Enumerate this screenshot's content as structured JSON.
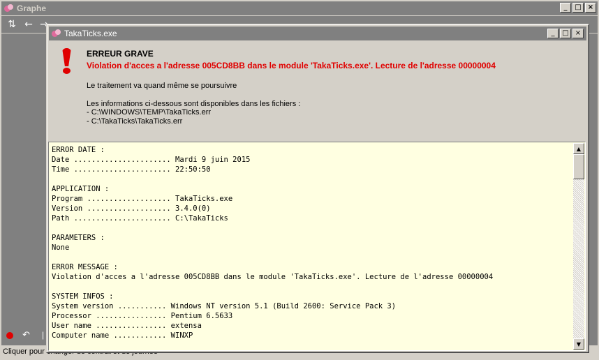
{
  "parent_window": {
    "title": "Graphe",
    "status_text": "Cliquer pour changer de contrat et de journée",
    "toolbar_icons": [
      "refresh-icon",
      "back-arrow-icon",
      "forward-arrow-icon"
    ]
  },
  "window_controls": {
    "minimize": "_",
    "maximize": "□",
    "close": "×"
  },
  "dialog": {
    "title": "TakaTicks.exe",
    "error_title": "ERREUR GRAVE",
    "error_message": "Violation d'acces a l'adresse 005CD8BB dans le module 'TakaTicks.exe'. Lecture de l'adresse 00000004",
    "continue_text": "Le traitement va quand même se poursuivre",
    "files_intro": "Les informations ci-dessous sont disponibles dans les fichiers :",
    "file1": "- C:\\WINDOWS\\TEMP\\TakaTicks.err",
    "file2": "- C:\\TakaTicks\\TakaTicks.err",
    "report_lines": [
      "ERROR DATE :",
      "Date ...................... Mardi 9 juin 2015",
      "Time ...................... 22:50:50",
      "",
      "APPLICATION :",
      "Program ................... TakaTicks.exe",
      "Version ................... 3.4.0(0)",
      "Path ...................... C:\\TakaTicks",
      "",
      "PARAMETERS :",
      "None",
      "",
      "ERROR MESSAGE :",
      "Violation d'acces a l'adresse 005CD8BB dans le module 'TakaTicks.exe'. Lecture de l'adresse 00000004",
      "",
      "SYSTEM INFOS :",
      "System version ........... Windows NT version 5.1 (Build 2600: Service Pack 3)",
      "Processor ................ Pentium 6.5633",
      "User name ................ extensa",
      "Computer name ............ WINXP"
    ]
  },
  "colors": {
    "error_red": "#e00000",
    "titlebar_inactive": "#808080",
    "report_background": "#ffffe1",
    "face": "#d4d0c8"
  }
}
